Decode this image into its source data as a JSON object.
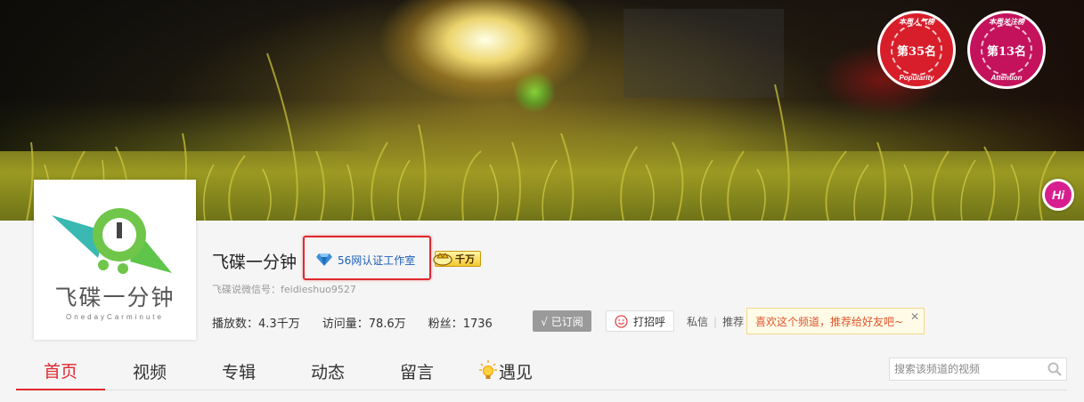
{
  "medals": {
    "popularity": {
      "top_text": "本周人气榜",
      "rank": "第35名",
      "bottom_text": "Popularity"
    },
    "attention": {
      "top_text": "本周关注榜",
      "rank": "第13名",
      "bottom_text": "Attention"
    }
  },
  "hi_button": "Hi",
  "avatar": {
    "logo_text": "飞碟一分钟",
    "logo_sub": "OnedayCarminute"
  },
  "channel": {
    "name": "飞碟一分钟",
    "cert_label": "56网认证工作室",
    "qianwan_label": "千万",
    "wechat_line": "飞碟说微信号：feidieshuo9527"
  },
  "stats": [
    {
      "label": "播放数：",
      "value": "4.3千万"
    },
    {
      "label": "访问量：",
      "value": "78.6万"
    },
    {
      "label": "粉丝：",
      "value": "1736"
    }
  ],
  "buttons": {
    "subscribed": "√ 已订阅",
    "greet": "打招呼",
    "message": "私信",
    "recommend": "推荐"
  },
  "recommend_tip": {
    "text": "喜欢这个频道，推荐给好友吧~",
    "close": "✕"
  },
  "tabs": [
    {
      "label": "首页",
      "active": true
    },
    {
      "label": "视频"
    },
    {
      "label": "专辑"
    },
    {
      "label": "动态"
    },
    {
      "label": "留言"
    },
    {
      "label": "遇见"
    }
  ],
  "search": {
    "placeholder": "搜索该频道的视频"
  },
  "colors": {
    "accent": "#e0282e",
    "cert_blue": "#1d5fb8",
    "medal_red": "#d81e2a",
    "medal_magenta": "#c4125c"
  }
}
